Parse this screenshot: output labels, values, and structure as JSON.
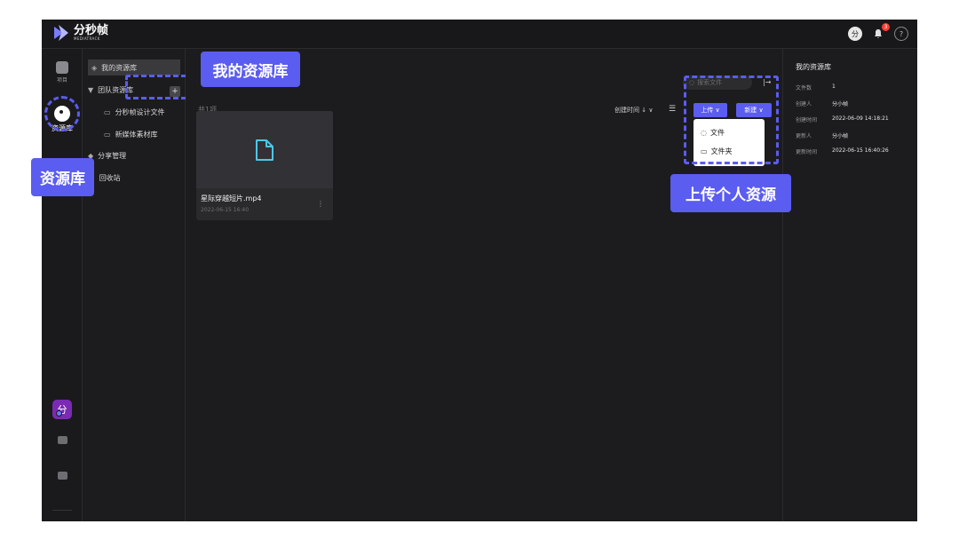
{
  "app": {
    "logo_cn": "分秒帧",
    "logo_en": "MEDIATRACK"
  },
  "topbar": {
    "user_icon_text": "分",
    "notification_count": "3",
    "help_label": "?"
  },
  "rail": {
    "items": [
      {
        "label": "项目",
        "icon": "project-icon"
      },
      {
        "label": "资源库",
        "icon": "library-icon"
      }
    ],
    "avatar_text": "分",
    "collapse_label": "←|"
  },
  "tree": {
    "my_library": "我的资源库",
    "team_library": "团队资源库",
    "team_children": [
      "分秒帧设计文件",
      "新媒体素材库"
    ],
    "share_manage": "分享管理",
    "recycle_bin": "回收站",
    "add_label": "+"
  },
  "main": {
    "total_text": "共1项",
    "sort_label": "创建时间 ↓ ∨",
    "search_placeholder": "搜索文件",
    "upload_label": "上传 ∨",
    "new_label": "新建 ∨",
    "upload_menu": [
      "文件",
      "文件夹"
    ],
    "files": [
      {
        "name": "星际穿越短片.mp4",
        "date": "2022-06-15 16:40"
      }
    ]
  },
  "info": {
    "title": "我的资源库",
    "rows": [
      {
        "key": "文件数",
        "value": "1"
      },
      {
        "key": "创建人",
        "value": "分小帧"
      },
      {
        "key": "创建时间",
        "value": "2022-06-09 14:18:21"
      },
      {
        "key": "更新人",
        "value": "分小帧"
      },
      {
        "key": "更新时间",
        "value": "2022-06-15 16:40:26"
      }
    ]
  },
  "callouts": {
    "my_library": "我的资源库",
    "resource_library": "资源库",
    "upload_personal": "上传个人资源"
  },
  "colors": {
    "accent": "#5b5cf0",
    "background": "#1c1c1e",
    "avatar": "#7a2ab5",
    "badge": "#ff3b30"
  }
}
